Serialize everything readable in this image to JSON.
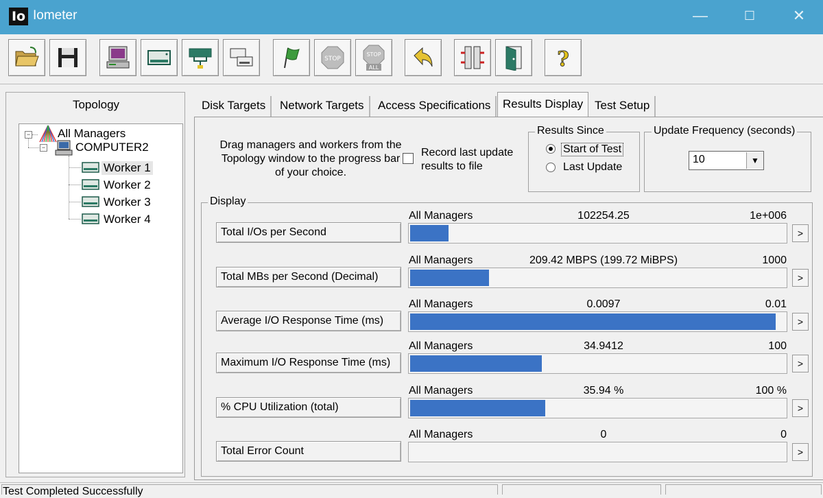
{
  "window": {
    "logo": "Io",
    "title": "Iometer",
    "minimize": "—",
    "maximize": "☐",
    "close": "✕"
  },
  "toolbar": {
    "buttons": [
      {
        "icon": "open-folder-icon"
      },
      {
        "icon": "save-disk-icon"
      },
      {
        "icon": "start-manager-icon"
      },
      {
        "icon": "start-disk-worker-icon"
      },
      {
        "icon": "start-network-worker-icon"
      },
      {
        "icon": "duplicate-worker-icon"
      },
      {
        "icon": "start-tests-flag-icon"
      },
      {
        "icon": "stop-icon"
      },
      {
        "icon": "stop-all-icon"
      },
      {
        "icon": "reset-workers-icon"
      },
      {
        "icon": "disconnect-manager-icon"
      },
      {
        "icon": "exit-door-icon"
      },
      {
        "icon": "help-question-icon"
      }
    ],
    "stop_label": "STOP",
    "stop_all_label": "STOP",
    "stop_all_sub": "ALL"
  },
  "topology": {
    "label": "Topology",
    "root": "All Managers",
    "computer": "COMPUTER2",
    "workers": [
      "Worker 1",
      "Worker 2",
      "Worker 3",
      "Worker 4"
    ]
  },
  "tabs": [
    {
      "label": "Disk Targets"
    },
    {
      "label": "Network Targets"
    },
    {
      "label": "Access Specifications"
    },
    {
      "label": "Results Display",
      "active": true
    },
    {
      "label": "Test Setup"
    }
  ],
  "results": {
    "instructions": "Drag managers and workers from the Topology window to the progress bar of your choice.",
    "record_label": "Record last update results to file",
    "record_checked": false,
    "results_since_label": "Results Since",
    "results_since_options": [
      "Start of Test",
      "Last Update"
    ],
    "results_since_selected": "Start of Test",
    "update_freq_label": "Update Frequency (seconds)",
    "update_freq_value": "10"
  },
  "display": {
    "label": "Display",
    "arrow": ">",
    "rows": [
      {
        "button": "Total I/Os per Second",
        "target": "All Managers",
        "value": "102254.25",
        "max": "1e+006",
        "fraction": 0.102
      },
      {
        "button": "Total MBs per Second (Decimal)",
        "target": "All Managers",
        "value": "209.42 MBPS (199.72 MiBPS)",
        "max": "1000",
        "fraction": 0.209
      },
      {
        "button": "Average I/O Response Time (ms)",
        "target": "All Managers",
        "value": "0.0097",
        "max": "0.01",
        "fraction": 0.97
      },
      {
        "button": "Maximum I/O Response Time (ms)",
        "target": "All Managers",
        "value": "34.9412",
        "max": "100",
        "fraction": 0.349
      },
      {
        "button": "% CPU Utilization (total)",
        "target": "All Managers",
        "value": "35.94 %",
        "max": "100 %",
        "fraction": 0.359
      },
      {
        "button": "Total Error Count",
        "target": "All Managers",
        "value": "0",
        "max": "0",
        "fraction": 0
      }
    ]
  },
  "status": {
    "text": "Test Completed Successfully"
  },
  "colors": {
    "titlebar": "#4aa3cf",
    "bar_fill": "#3b73c5"
  }
}
